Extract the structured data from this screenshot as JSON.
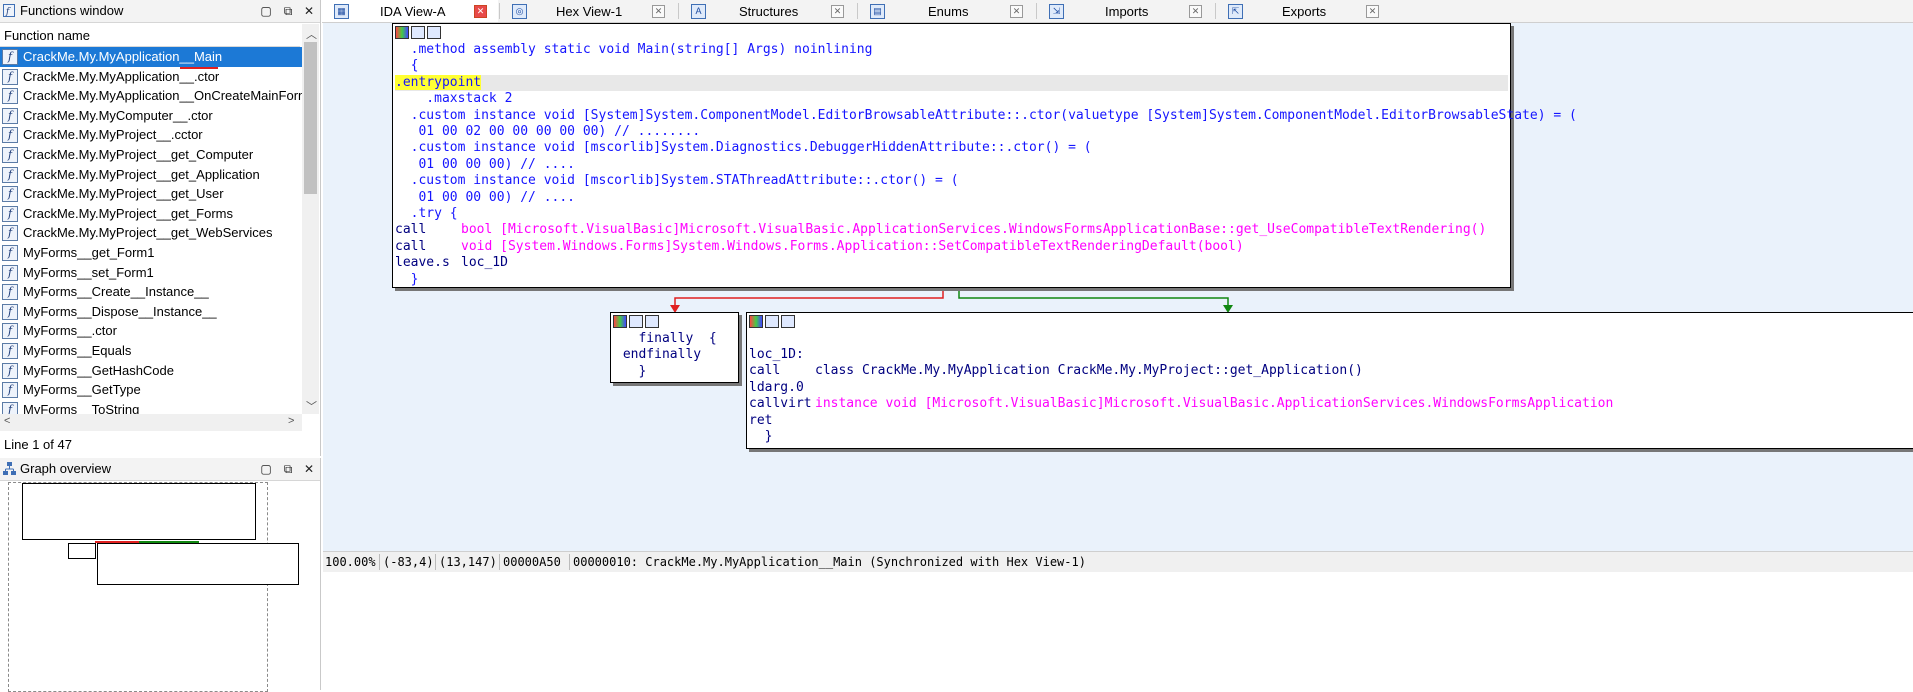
{
  "functions_window": {
    "title": "Functions window",
    "column_header": "Function name",
    "items": [
      "CrackMe.My.MyApplication__Main",
      "CrackMe.My.MyApplication__.ctor",
      "CrackMe.My.MyApplication__OnCreateMainForm",
      "CrackMe.My.MyComputer__.ctor",
      "CrackMe.My.MyProject__.cctor",
      "CrackMe.My.MyProject__get_Computer",
      "CrackMe.My.MyProject__get_Application",
      "CrackMe.My.MyProject__get_User",
      "CrackMe.My.MyProject__get_Forms",
      "CrackMe.My.MyProject__get_WebServices",
      "MyForms__get_Form1",
      "MyForms__set_Form1",
      "MyForms__Create__Instance__",
      "MyForms__Dispose__Instance__",
      "MyForms__.ctor",
      "MyForms__Equals",
      "MyForms__GetHashCode",
      "MyForms__GetType",
      "MyForms__ToString"
    ],
    "selected_index": 0,
    "line_status": "Line 1 of 47"
  },
  "graph_overview": {
    "title": "Graph overview"
  },
  "tabs": [
    {
      "label": "IDA View-A",
      "icon": "graph-icon",
      "active": true
    },
    {
      "label": "Hex View-1",
      "icon": "hex-icon",
      "active": false
    },
    {
      "label": "Structures",
      "icon": "structures-icon",
      "active": false
    },
    {
      "label": "Enums",
      "icon": "enums-icon",
      "active": false
    },
    {
      "label": "Imports",
      "icon": "imports-icon",
      "active": false
    },
    {
      "label": "Exports",
      "icon": "exports-icon",
      "active": false
    }
  ],
  "graph": {
    "main_node": [
      {
        "text": "  .method assembly static void Main(string[] Args) noinlining",
        "style": "blue"
      },
      {
        "text": "  {",
        "style": "blue"
      },
      {
        "text": ".entrypoint",
        "style": "entry"
      },
      {
        "text": "    .maxstack 2",
        "style": "blue"
      },
      {
        "text": "  .custom instance void [System]System.ComponentModel.EditorBrowsableAttribute::.ctor(valuetype [System]System.ComponentModel.EditorBrowsableState) = (",
        "style": "blue"
      },
      {
        "text": "   01 00 02 00 00 00 00 00) // ........",
        "style": "blue"
      },
      {
        "text": "  .custom instance void [mscorlib]System.Diagnostics.DebuggerHiddenAttribute::.ctor() = (",
        "style": "blue"
      },
      {
        "text": "   01 00 00 00) // ....",
        "style": "blue"
      },
      {
        "text": "  .custom instance void [mscorlib]System.STAThreadAttribute::.ctor() = (",
        "style": "blue"
      },
      {
        "text": "   01 00 00 00) // ....",
        "style": "blue"
      },
      {
        "text": "  .try {",
        "style": "blue"
      }
    ],
    "main_calls": [
      {
        "op": "call",
        "arg": "bool [Microsoft.VisualBasic]Microsoft.VisualBasic.ApplicationServices.WindowsFormsApplicationBase::get_UseCompatibleTextRendering()"
      },
      {
        "op": "call",
        "arg": "void [System.Windows.Forms]System.Windows.Forms.Application::SetCompatibleTextRenderingDefault(bool)"
      },
      {
        "op": "leave.s",
        "arg": "loc_1D"
      }
    ],
    "main_close": "  }",
    "finally_node": [
      "   finally  {",
      " endfinally",
      "   }"
    ],
    "loc_node": {
      "label": "loc_1D:",
      "lines": [
        {
          "op": "call",
          "arg": "class CrackMe.My.MyApplication CrackMe.My.MyProject::get_Application()",
          "style": "navy"
        },
        {
          "op": "ldarg.0",
          "arg": "",
          "style": "navy"
        },
        {
          "op": "callvirt",
          "arg": "instance void [Microsoft.VisualBasic]Microsoft.VisualBasic.ApplicationServices.WindowsFormsApplication",
          "style": "pink"
        },
        {
          "op": "ret",
          "arg": "",
          "style": "navy"
        }
      ],
      "close": "  }"
    }
  },
  "status_bar": {
    "zoom": "100.00%",
    "coords1": "(-83,4)",
    "coords2": "(13,147)",
    "offset": "00000A50",
    "location": "00000010: CrackMe.My.MyApplication__Main (Synchronized with Hex View-1)"
  },
  "colors": {
    "selection": "#1c79d6",
    "graph_bg": "#eaf2fb",
    "code_blue": "#1515ff",
    "code_pink": "#ff00ff",
    "edge_red": "#e02020",
    "edge_green": "#118811",
    "entry_highlight": "#ffff33"
  }
}
